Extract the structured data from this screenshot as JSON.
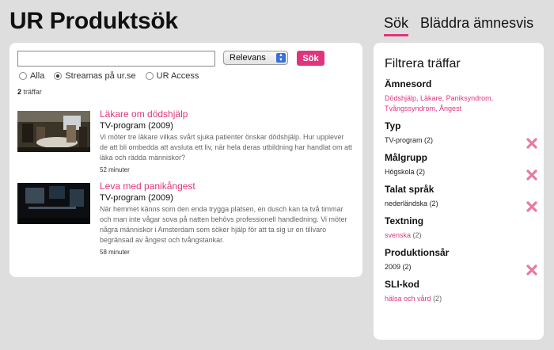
{
  "header": {
    "title": "UR Produktsök"
  },
  "nav": {
    "tabs": [
      {
        "label": "Sök",
        "active": true
      },
      {
        "label": "Bläddra ämnesvis",
        "active": false
      }
    ]
  },
  "search": {
    "query": "",
    "placeholder": "",
    "sort": "Relevans",
    "button": "Sök",
    "scope_options": [
      {
        "label": "Alla",
        "checked": false
      },
      {
        "label": "Streamas på ur.se",
        "checked": true
      },
      {
        "label": "UR Access",
        "checked": false
      }
    ]
  },
  "results": {
    "count": "2",
    "count_label": "träffar",
    "items": [
      {
        "title": "Läkare om dödshjälp",
        "type": "TV-program (2009)",
        "description": "Vi möter tre läkare vilkas svårt sjuka patienter önskar dödshjälp. Hur upplever de att bli ombedda att avsluta ett liv, när hela deras utbildning har handlat om att läka och rädda människor?",
        "duration": "52 minuter"
      },
      {
        "title": "Leva med panikångest",
        "type": "TV-program (2009)",
        "description": "När hemmet känns som den enda trygga platsen, en dusch kan ta två timmar och man inte vågar sova på natten behövs professionell handledning. Vi möter några människor i Amsterdam som söker hjälp för att ta sig ur en tillvaro begränsad av ångest och tvångstankar.",
        "duration": "58 minuter"
      }
    ]
  },
  "filters": {
    "heading": "Filtrera träffar",
    "groups": [
      {
        "name": "Ämnesord",
        "links": [
          "Dödshjälp,",
          "Läkare,",
          "Paniksyndrom,",
          "Tvångssyndrom,",
          "Ångest"
        ]
      },
      {
        "name": "Typ",
        "value": "TV-program",
        "count": "(2)",
        "removable": true
      },
      {
        "name": "Målgrupp",
        "value": "Högskola",
        "count": "(2)",
        "removable": true
      },
      {
        "name": "Talat språk",
        "value": "nederländska",
        "count": "(2)",
        "removable": true
      },
      {
        "name": "Textning",
        "value": "svenska",
        "count": "(2)",
        "removable": false
      },
      {
        "name": "Produktionsår",
        "value": "2009",
        "count": "(2)",
        "removable": true
      },
      {
        "name": "SLI-kod",
        "value": "hälsa och vård",
        "count": "(2)",
        "removable": false
      }
    ]
  },
  "colors": {
    "accent": "#e0357d",
    "background": "#dedede",
    "remove_icon": "#e87a9f"
  },
  "icons": {
    "remove": "remove-x-icon",
    "select_arrows": "select-arrows-icon"
  }
}
